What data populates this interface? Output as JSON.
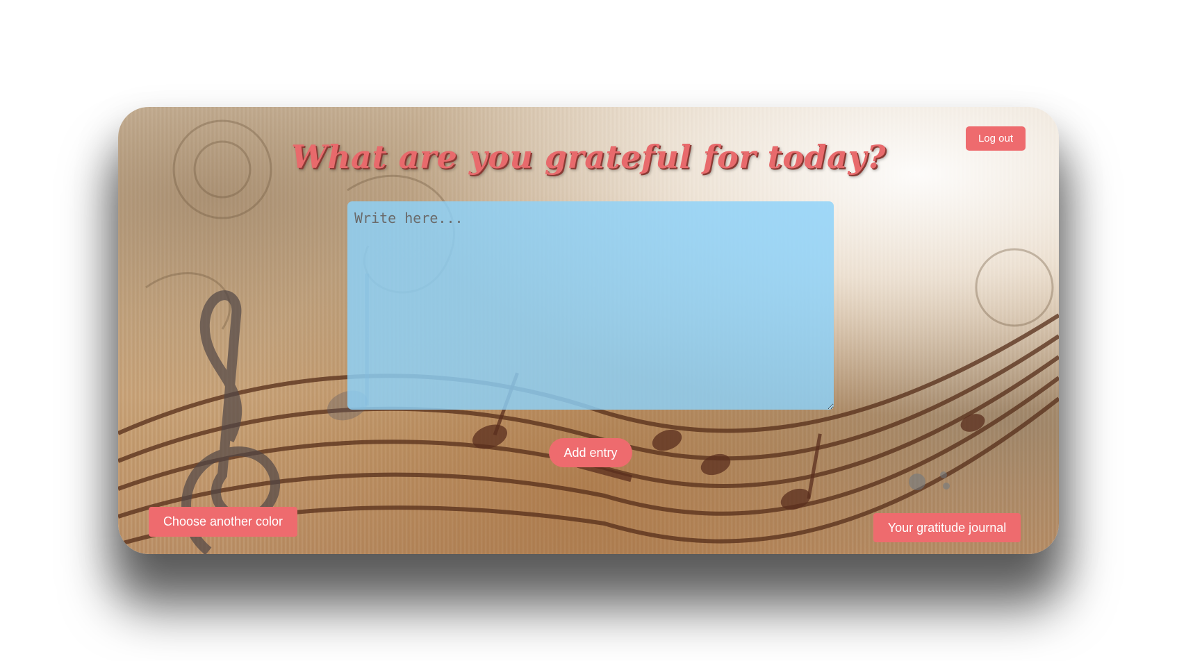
{
  "page": {
    "title": "What are you grateful for today?"
  },
  "entry": {
    "placeholder": "Write here...",
    "value": ""
  },
  "buttons": {
    "logout_label": "Log out",
    "add_entry_label": "Add entry",
    "choose_color_label": "Choose another color",
    "journal_label": "Your gratitude journal"
  },
  "colors": {
    "accent": "#ee6b6e",
    "title": "#e86a6c",
    "textarea_bg": "#8cd2fa"
  },
  "background": {
    "theme": "vintage sheet music parchment",
    "icons": [
      "treble-clef-icon",
      "bass-clef-icon",
      "music-note-icon"
    ]
  }
}
